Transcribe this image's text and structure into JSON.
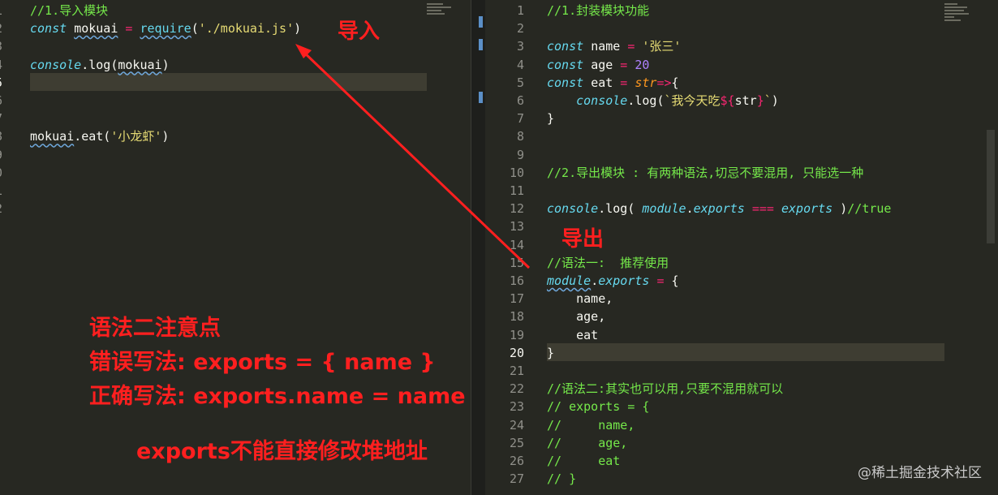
{
  "left_editor": {
    "lines": [
      {
        "num": "1",
        "tokens": [
          {
            "t": "//1.导入模块",
            "c": "c"
          }
        ]
      },
      {
        "num": "2",
        "tokens": [
          {
            "t": "const ",
            "c": "k"
          },
          {
            "t": "mokuai",
            "c": "v sq"
          },
          {
            "t": " = ",
            "c": "o"
          },
          {
            "t": "require",
            "c": "f sq"
          },
          {
            "t": "(",
            "c": "p"
          },
          {
            "t": "'./mokuai.js'",
            "c": "s"
          },
          {
            "t": ")",
            "c": "p"
          }
        ]
      },
      {
        "num": "3",
        "tokens": []
      },
      {
        "num": "4",
        "tokens": [
          {
            "t": "console",
            "c": "it"
          },
          {
            "t": ".log(",
            "c": "p"
          },
          {
            "t": "mokuai",
            "c": "v sq"
          },
          {
            "t": ")",
            "c": "p"
          }
        ]
      },
      {
        "num": "5",
        "tokens": [],
        "current": true
      },
      {
        "num": "6",
        "tokens": []
      },
      {
        "num": "7",
        "tokens": []
      },
      {
        "num": "8",
        "tokens": [
          {
            "t": "mokuai",
            "c": "v sq"
          },
          {
            "t": ".eat(",
            "c": "p"
          },
          {
            "t": "'小龙虾'",
            "c": "s"
          },
          {
            "t": ")",
            "c": "p"
          }
        ]
      },
      {
        "num": "9",
        "tokens": []
      },
      {
        "num": "0",
        "tokens": []
      },
      {
        "num": "1",
        "tokens": []
      },
      {
        "num": "2",
        "tokens": []
      }
    ]
  },
  "right_editor": {
    "lines": [
      {
        "num": "1",
        "tokens": [
          {
            "t": "//1.封装模块功能",
            "c": "c"
          }
        ]
      },
      {
        "num": "2",
        "tokens": []
      },
      {
        "num": "3",
        "tokens": [
          {
            "t": "const ",
            "c": "k"
          },
          {
            "t": "name",
            "c": "v"
          },
          {
            "t": " = ",
            "c": "o"
          },
          {
            "t": "'张三'",
            "c": "s"
          }
        ]
      },
      {
        "num": "4",
        "tokens": [
          {
            "t": "const ",
            "c": "k"
          },
          {
            "t": "age",
            "c": "v"
          },
          {
            "t": " = ",
            "c": "o"
          },
          {
            "t": "20",
            "c": "n"
          }
        ]
      },
      {
        "num": "5",
        "tokens": [
          {
            "t": "const ",
            "c": "k"
          },
          {
            "t": "eat",
            "c": "v"
          },
          {
            "t": " = ",
            "c": "o"
          },
          {
            "t": "str",
            "c": "ar"
          },
          {
            "t": "=>",
            "c": "o"
          },
          {
            "t": "{",
            "c": "p"
          }
        ]
      },
      {
        "num": "6",
        "tokens": [
          {
            "t": "    ",
            "c": "p"
          },
          {
            "t": "console",
            "c": "it"
          },
          {
            "t": ".log(",
            "c": "p"
          },
          {
            "t": "`我今天吃",
            "c": "s"
          },
          {
            "t": "${",
            "c": "o"
          },
          {
            "t": "str",
            "c": "v"
          },
          {
            "t": "}",
            "c": "o"
          },
          {
            "t": "`",
            "c": "s"
          },
          {
            "t": ")",
            "c": "p"
          }
        ]
      },
      {
        "num": "7",
        "tokens": [
          {
            "t": "}",
            "c": "p"
          }
        ]
      },
      {
        "num": "8",
        "tokens": []
      },
      {
        "num": "9",
        "tokens": []
      },
      {
        "num": "10",
        "tokens": [
          {
            "t": "//2.导出模块 : 有两种语法,切忌不要混用, 只能选一种",
            "c": "c"
          }
        ]
      },
      {
        "num": "11",
        "tokens": []
      },
      {
        "num": "12",
        "tokens": [
          {
            "t": "console",
            "c": "it"
          },
          {
            "t": ".log( ",
            "c": "p"
          },
          {
            "t": "module",
            "c": "it"
          },
          {
            "t": ".",
            "c": "p"
          },
          {
            "t": "exports",
            "c": "it"
          },
          {
            "t": " === ",
            "c": "o"
          },
          {
            "t": "exports",
            "c": "it"
          },
          {
            "t": " )",
            "c": "p"
          },
          {
            "t": "//true",
            "c": "c"
          }
        ]
      },
      {
        "num": "13",
        "tokens": []
      },
      {
        "num": "14",
        "tokens": []
      },
      {
        "num": "15",
        "tokens": [
          {
            "t": "//语法一:  推荐使用",
            "c": "c"
          }
        ]
      },
      {
        "num": "16",
        "tokens": [
          {
            "t": "module",
            "c": "it sq"
          },
          {
            "t": ".",
            "c": "p"
          },
          {
            "t": "exports",
            "c": "it"
          },
          {
            "t": " = ",
            "c": "o"
          },
          {
            "t": "{",
            "c": "p"
          }
        ]
      },
      {
        "num": "17",
        "tokens": [
          {
            "t": "    name,",
            "c": "p"
          }
        ]
      },
      {
        "num": "18",
        "tokens": [
          {
            "t": "    age,",
            "c": "p"
          }
        ]
      },
      {
        "num": "19",
        "tokens": [
          {
            "t": "    eat",
            "c": "p"
          }
        ]
      },
      {
        "num": "20",
        "tokens": [
          {
            "t": "}",
            "c": "p"
          }
        ],
        "current": true
      },
      {
        "num": "21",
        "tokens": []
      },
      {
        "num": "22",
        "tokens": [
          {
            "t": "//语法二:其实也可以用,只要不混用就可以",
            "c": "c"
          }
        ]
      },
      {
        "num": "23",
        "tokens": [
          {
            "t": "// exports = {",
            "c": "c"
          }
        ]
      },
      {
        "num": "24",
        "tokens": [
          {
            "t": "//     name,",
            "c": "c"
          }
        ]
      },
      {
        "num": "25",
        "tokens": [
          {
            "t": "//     age,",
            "c": "c"
          }
        ]
      },
      {
        "num": "26",
        "tokens": [
          {
            "t": "//     eat",
            "c": "c"
          }
        ]
      },
      {
        "num": "27",
        "tokens": [
          {
            "t": "// }",
            "c": "c"
          }
        ]
      }
    ]
  },
  "annotations": {
    "import_label": "导入",
    "export_label": "导出",
    "note_title": "语法二注意点",
    "wrong_usage": "错误写法:  exports = { name }",
    "right_usage": "正确写法:  exports.name = name",
    "heap_note": "exports不能直接修改堆地址"
  },
  "watermark": "@稀土掘金技术社区",
  "colors": {
    "annotation": "#ff1f1f",
    "background": "#272822",
    "comment": "#75e84a"
  }
}
